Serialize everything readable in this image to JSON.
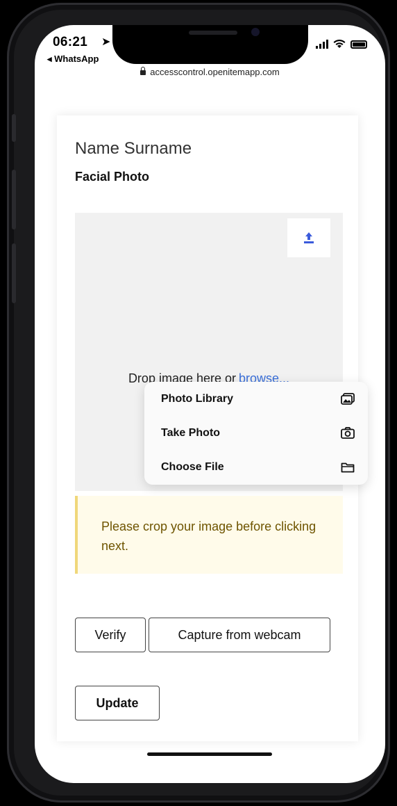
{
  "status_bar": {
    "time": "06:21",
    "location_arrow": "➤",
    "back_app": "◂ WhatsApp"
  },
  "browser": {
    "url": "accesscontrol.openitemapp.com"
  },
  "page": {
    "name": "Name Surname",
    "section_title": "Facial Photo",
    "dropzone": {
      "prompt": "Drop image here or",
      "browse_link": "browse..."
    },
    "menu": [
      {
        "label": "Photo Library",
        "icon": "photo-library-icon"
      },
      {
        "label": "Take Photo",
        "icon": "camera-icon"
      },
      {
        "label": "Choose File",
        "icon": "folder-icon"
      }
    ],
    "alert": "Please crop your image before clicking next.",
    "buttons": {
      "verify": "Verify",
      "webcam": "Capture from webcam",
      "update": "Update"
    }
  },
  "colors": {
    "link": "#3a6fd8",
    "upload_icon": "#3b5bdb",
    "alert_bg": "#fffbea",
    "alert_border": "#f0d77a",
    "alert_text": "#6e5400"
  }
}
